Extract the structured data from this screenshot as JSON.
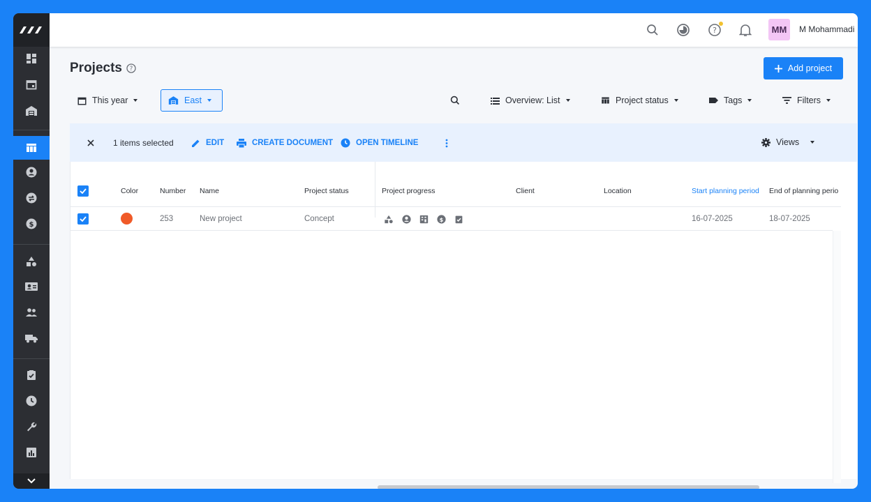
{
  "colors": {
    "accent": "#1a82f7",
    "sidebar": "#2c2e33",
    "project_color": "#f05a28",
    "avatar_bg": "#f3c6f5"
  },
  "topbar": {
    "avatar_initials": "MM",
    "user_name": "M Mohammadi"
  },
  "header": {
    "title": "Projects",
    "add_button": "Add project"
  },
  "filters": {
    "period": "This year",
    "region": "East",
    "overview": "Overview: List",
    "project_status": "Project status",
    "tags": "Tags",
    "filters": "Filters"
  },
  "selection_bar": {
    "selected_text": "1 items selected",
    "edit": "EDIT",
    "create_document": "CREATE DOCUMENT",
    "open_timeline": "OPEN TIMELINE",
    "views": "Views"
  },
  "table": {
    "columns": [
      "Color",
      "Number",
      "Name",
      "Project status",
      "Project progress",
      "Client",
      "Location",
      "Start planning period",
      "End of planning perio"
    ],
    "rows": [
      {
        "number": "253",
        "name": "New project",
        "status": "Concept",
        "client": "",
        "location": "",
        "start": "16-07-2025",
        "end": "18-07-2025"
      }
    ]
  },
  "sidebar": {
    "icons": [
      "dashboard-icon",
      "calendar-icon",
      "warehouse-icon",
      "projects-table-icon",
      "contact-icon",
      "swap-icon",
      "finance-icon",
      "shapes-icon",
      "contact-card-icon",
      "people-icon",
      "truck-icon",
      "checklist-icon",
      "clock-icon",
      "wrench-icon",
      "report-icon"
    ]
  }
}
